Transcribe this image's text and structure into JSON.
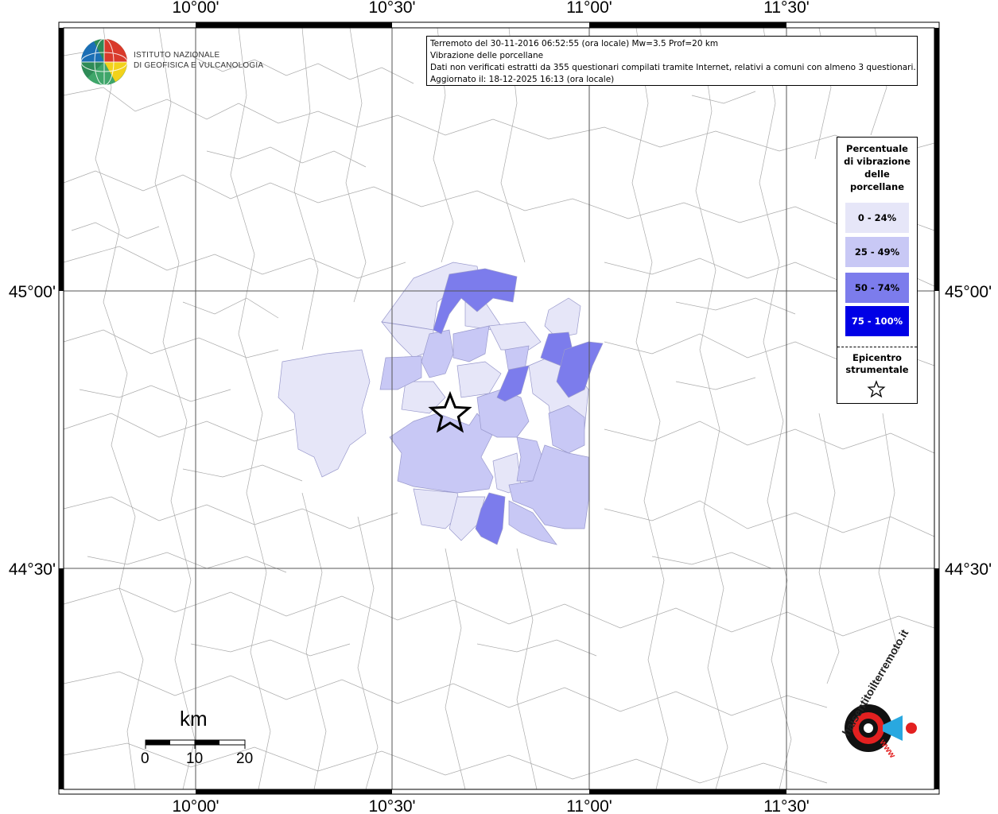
{
  "map": {
    "longitude_ticks": [
      "10°00'",
      "10°30'",
      "11°00'",
      "11°30'"
    ],
    "latitude_ticks": [
      "45°00'",
      "44°30'"
    ]
  },
  "logo": {
    "line1": "ISTITUTO NAZIONALE",
    "line2": "DI GEOFISICA E VULCANOLOGIA"
  },
  "info_box": {
    "line1": "Terremoto del 30-11-2016 06:52:55 (ora locale) Mw=3.5 Prof=20 km",
    "line2": "Vibrazione delle porcellane",
    "line3": "Dati non verificati estratti da 355 questionari compilati tramite Internet, relativi a comuni con almeno 3 questionari.",
    "line4": "Aggiornato il: 18-12-2025 16:13 (ora locale)"
  },
  "legend": {
    "title_line1": "Percentuale",
    "title_line2": "di vibrazione",
    "title_line3": "delle",
    "title_line4": "porcellane",
    "classes": [
      {
        "label": "0 - 24%",
        "color": "#e6e6f8",
        "text_color": "#000000"
      },
      {
        "label": "25 - 49%",
        "color": "#c8c8f5",
        "text_color": "#000000"
      },
      {
        "label": "50 - 74%",
        "color": "#7c7cec",
        "text_color": "#000000"
      },
      {
        "label": "75 - 100%",
        "color": "#0000e6",
        "text_color": "#ffffff"
      }
    ],
    "epicenter_line1": "Epicentro",
    "epicenter_line2": "strumentale"
  },
  "scale_bar": {
    "unit": "km",
    "labels": [
      "0",
      "10",
      "20"
    ]
  },
  "watermark": {
    "text": "haisentitoilterremoto.it",
    "url": "www"
  }
}
